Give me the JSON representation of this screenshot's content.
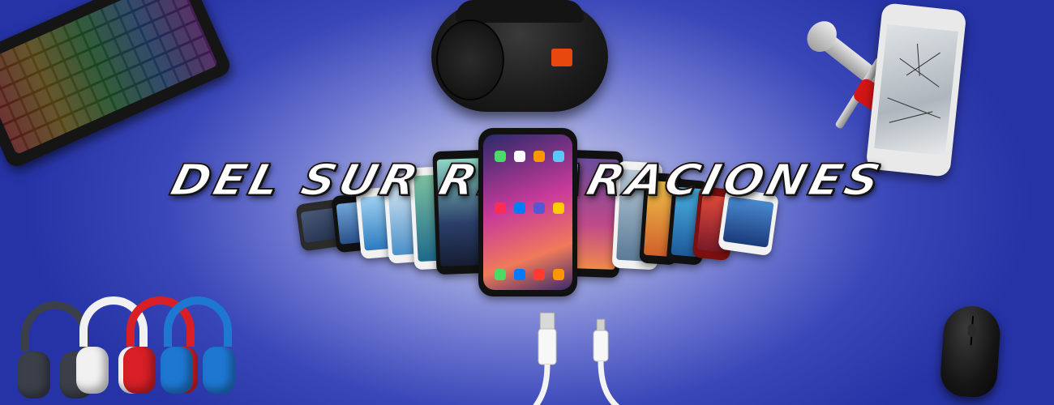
{
  "banner": {
    "title": "DEL SUR REPARACIONES"
  },
  "colors": {
    "background": "#3a47b8",
    "title_red": "#e01010",
    "title_outline": "#111111"
  },
  "icons": [
    "gaming-keyboard-icon",
    "bluetooth-speaker-icon",
    "broken-smartphone-icon",
    "wrench-icon",
    "screwdriver-icon",
    "smartphones-fan-icon",
    "headphones-icon",
    "usb-cable-icon",
    "mouse-icon"
  ]
}
